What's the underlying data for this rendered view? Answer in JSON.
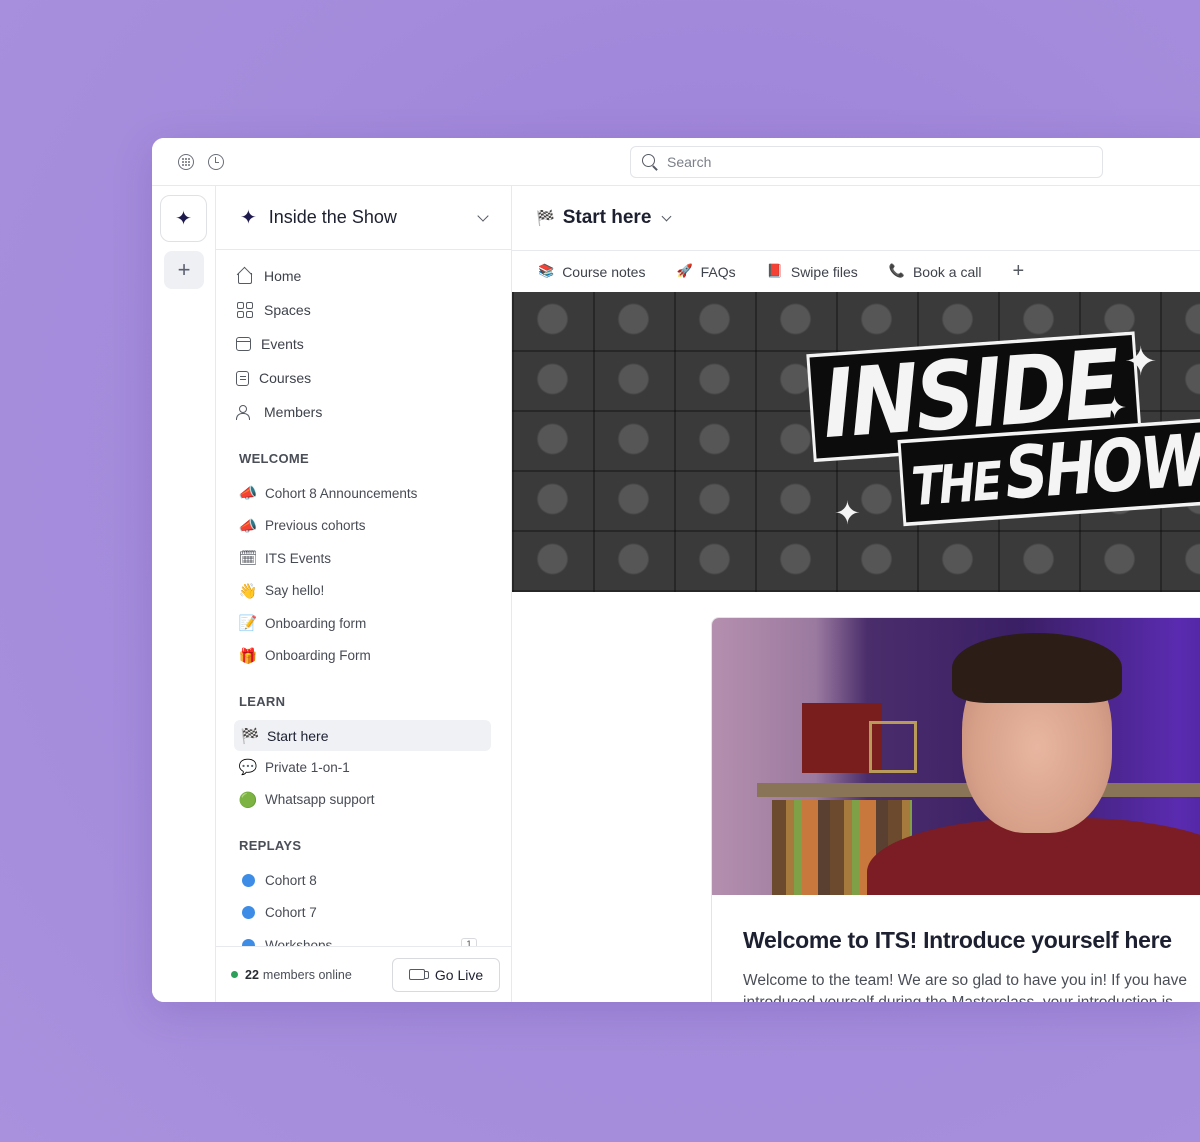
{
  "topbar": {
    "search_placeholder": "Search"
  },
  "community": {
    "name": "Inside the Show"
  },
  "nav": [
    {
      "label": "Home",
      "icon": "home-icon"
    },
    {
      "label": "Spaces",
      "icon": "spaces-icon"
    },
    {
      "label": "Events",
      "icon": "calendar-icon"
    },
    {
      "label": "Courses",
      "icon": "courses-icon"
    },
    {
      "label": "Members",
      "icon": "members-icon"
    }
  ],
  "sections": {
    "welcome": {
      "label": "WELCOME",
      "items": [
        {
          "label": "Cohort 8 Announcements",
          "emoji": "📣"
        },
        {
          "label": "Previous cohorts",
          "emoji": "📣"
        },
        {
          "label": "ITS Events",
          "emoji": "🗓"
        },
        {
          "label": "Say hello!",
          "emoji": "👋"
        },
        {
          "label": "Onboarding form",
          "emoji": "📝"
        },
        {
          "label": "Onboarding Form",
          "emoji": "🎁"
        }
      ]
    },
    "learn": {
      "label": "LEARN",
      "items": [
        {
          "label": "Start here",
          "emoji": "🏁",
          "active": true
        },
        {
          "label": "Private 1-on-1",
          "emoji": "💬"
        },
        {
          "label": "Whatsapp support",
          "emoji": "🟢"
        }
      ]
    },
    "replays": {
      "label": "REPLAYS",
      "items": [
        {
          "label": "Cohort 8"
        },
        {
          "label": "Cohort 7"
        },
        {
          "label": "Workshops",
          "badge": "1"
        }
      ]
    }
  },
  "footer": {
    "online_count": "22",
    "online_text": "members online",
    "go_live_label": "Go Live",
    "online_color": "#2e9e5b"
  },
  "main": {
    "title": "Start here",
    "title_emoji": "🏁",
    "tabs": [
      {
        "label": "Course notes",
        "emoji": "📚"
      },
      {
        "label": "FAQs",
        "emoji": "🚀"
      },
      {
        "label": "Swipe files",
        "emoji": "📕"
      },
      {
        "label": "Book a call",
        "emoji": "📞"
      }
    ],
    "banner": {
      "line1": "Inside",
      "line2_small": "The",
      "line2": "Show"
    },
    "post": {
      "title": "Welcome to ITS! Introduce yourself here",
      "text_line1": "Welcome to the team! We are so glad to have you in! If you have",
      "text_line2": "introduced yourself during the Masterclass, your introduction is"
    }
  },
  "colors": {
    "accent_blue": "#3d8ce6",
    "background_purple": "#a48bdb"
  }
}
